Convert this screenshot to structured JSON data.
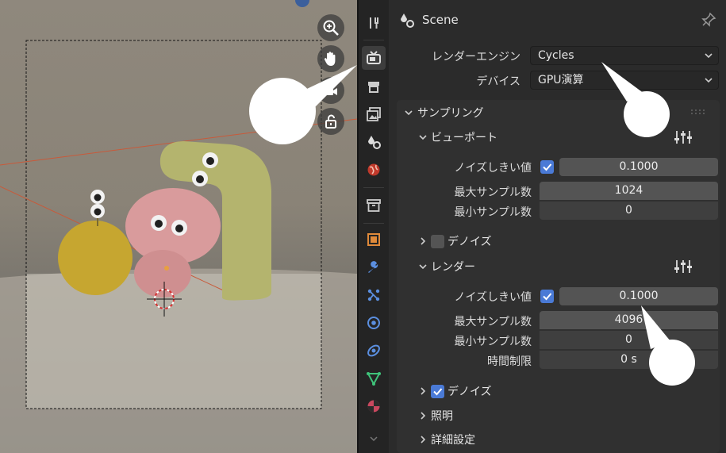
{
  "header": {
    "scene_label": "Scene"
  },
  "render": {
    "engine_label": "レンダーエンジン",
    "engine_value": "Cycles",
    "device_label": "デバイス",
    "device_value": "GPU演算"
  },
  "sampling": {
    "title": "サンプリング",
    "viewport": {
      "title": "ビューポート",
      "noise_label": "ノイズしきい値",
      "noise_value": "0.1000",
      "max_label": "最大サンプル数",
      "max_value": "1024",
      "min_label": "最小サンプル数",
      "min_value": "0",
      "denoise_label": "デノイズ"
    },
    "render": {
      "title": "レンダー",
      "noise_label": "ノイズしきい値",
      "noise_value": "0.1000",
      "max_label": "最大サンプル数",
      "max_value": "4096",
      "min_label": "最小サンプル数",
      "min_value": "0",
      "time_label": "時間制限",
      "time_value": "0 s",
      "denoise_label": "デノイズ"
    },
    "lighting_label": "照明",
    "advanced_label": "詳細設定"
  },
  "colors": {
    "accent": "#4a7ad6",
    "panel": "#303030",
    "field": "#545454"
  }
}
